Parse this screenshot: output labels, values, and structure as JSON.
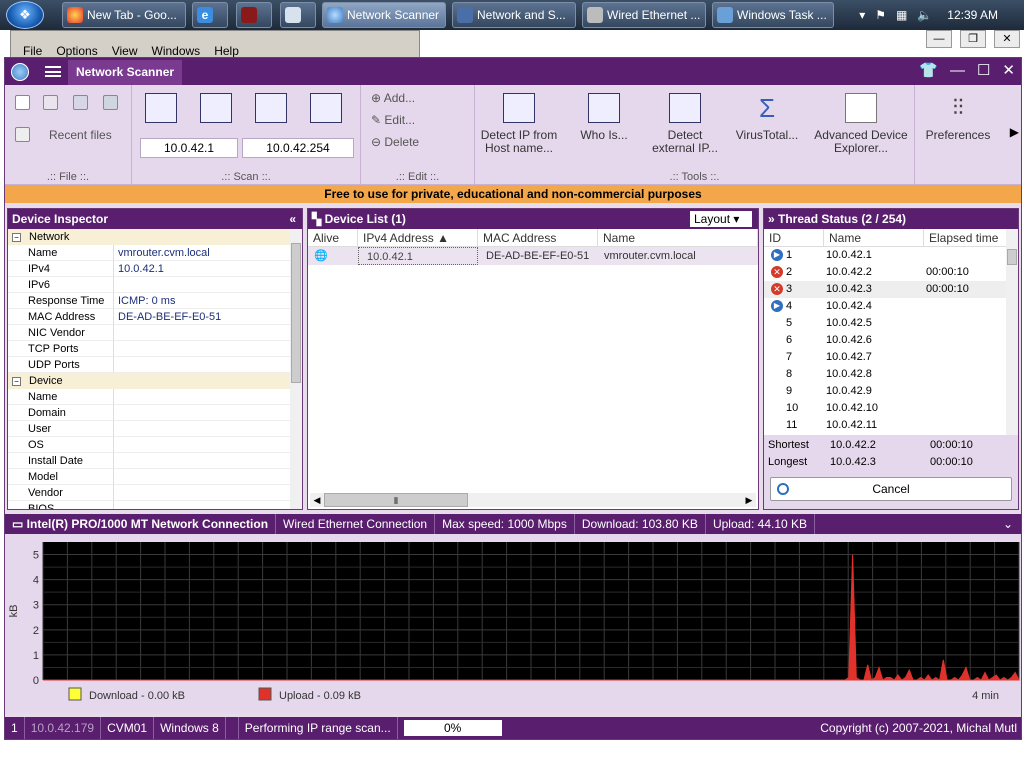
{
  "taskbar": {
    "tasks": [
      {
        "label": "New Tab - Goo..."
      },
      {
        "label": ""
      },
      {
        "label": ""
      },
      {
        "label": ""
      },
      {
        "label": "Network Scanner"
      },
      {
        "label": "Network and S..."
      },
      {
        "label": "Wired Ethernet ..."
      },
      {
        "label": "Windows Task ..."
      }
    ],
    "clock": "12:39 AM"
  },
  "bg_window": {
    "menu": [
      "File",
      "Options",
      "View",
      "Windows",
      "Help"
    ]
  },
  "app": {
    "tab": "Network Scanner",
    "ribbon": {
      "file": {
        "recent_label": "Recent files",
        "group_label": ".:: File ::."
      },
      "scan": {
        "from_ip": "10.0.42.1",
        "to_ip": "10.0.42.254",
        "group_label": ".:: Scan ::."
      },
      "edit": {
        "add": "Add...",
        "edit": "Edit...",
        "delete": "Delete",
        "group_label": ".:: Edit ::."
      },
      "tools": {
        "items": [
          "Detect IP from Host name...",
          "Who Is...",
          "Detect external IP...",
          "VirusTotal...",
          "Advanced Device Explorer..."
        ],
        "group_label": ".:: Tools ::."
      },
      "preferences": "Preferences"
    },
    "banner": "Free to use for private, educational and non-commercial  purposes"
  },
  "device_inspector": {
    "title": "Device Inspector",
    "groups": [
      {
        "name": "Network",
        "rows": [
          {
            "k": "Name",
            "v": "vmrouter.cvm.local"
          },
          {
            "k": "IPv4",
            "v": "10.0.42.1"
          },
          {
            "k": "IPv6",
            "v": ""
          },
          {
            "k": "Response Time",
            "v": "ICMP: 0 ms"
          },
          {
            "k": "MAC Address",
            "v": "DE-AD-BE-EF-E0-51"
          },
          {
            "k": "NIC Vendor",
            "v": ""
          },
          {
            "k": "TCP Ports",
            "v": ""
          },
          {
            "k": "UDP Ports",
            "v": ""
          }
        ]
      },
      {
        "name": "Device",
        "rows": [
          {
            "k": "Name",
            "v": ""
          },
          {
            "k": "Domain",
            "v": ""
          },
          {
            "k": "User",
            "v": ""
          },
          {
            "k": "OS",
            "v": ""
          },
          {
            "k": "Install Date",
            "v": ""
          },
          {
            "k": "Model",
            "v": ""
          },
          {
            "k": "Vendor",
            "v": ""
          },
          {
            "k": "BIOS",
            "v": ""
          }
        ]
      }
    ]
  },
  "device_list": {
    "title": "Device List (1)",
    "layout_label": "Layout",
    "columns": [
      "Alive",
      "IPv4 Address",
      "MAC Address",
      "Name"
    ],
    "rows": [
      {
        "ip": "10.0.42.1",
        "mac": "DE-AD-BE-EF-E0-51",
        "name": "vmrouter.cvm.local"
      }
    ]
  },
  "thread_status": {
    "title": "Thread Status (2 / 254)",
    "columns": [
      "ID",
      "Name",
      "Elapsed time"
    ],
    "rows": [
      {
        "state": "run",
        "id": "1",
        "name": "10.0.42.1",
        "time": ""
      },
      {
        "state": "err",
        "id": "2",
        "name": "10.0.42.2",
        "time": "00:00:10"
      },
      {
        "state": "err",
        "id": "3",
        "name": "10.0.42.3",
        "time": "00:00:10"
      },
      {
        "state": "run",
        "id": "4",
        "name": "10.0.42.4",
        "time": ""
      },
      {
        "state": "",
        "id": "5",
        "name": "10.0.42.5",
        "time": ""
      },
      {
        "state": "",
        "id": "6",
        "name": "10.0.42.6",
        "time": ""
      },
      {
        "state": "",
        "id": "7",
        "name": "10.0.42.7",
        "time": ""
      },
      {
        "state": "",
        "id": "8",
        "name": "10.0.42.8",
        "time": ""
      },
      {
        "state": "",
        "id": "9",
        "name": "10.0.42.9",
        "time": ""
      },
      {
        "state": "",
        "id": "10",
        "name": "10.0.42.10",
        "time": ""
      },
      {
        "state": "",
        "id": "11",
        "name": "10.0.42.11",
        "time": ""
      }
    ],
    "shortest": {
      "label": "Shortest",
      "name": "10.0.42.2",
      "time": "00:00:10"
    },
    "longest": {
      "label": "Longest",
      "name": "10.0.42.3",
      "time": "00:00:10"
    },
    "cancel": "Cancel"
  },
  "net_bar": {
    "adapter": "Intel(R) PRO/1000 MT Network Connection",
    "connection": "Wired Ethernet Connection",
    "max_speed": "Max speed: 1000 Mbps",
    "download": "Download: 103.80 KB",
    "upload": "Upload: 44.10 KB"
  },
  "chart_data": {
    "type": "area",
    "ylabel": "kB",
    "ylim": [
      0,
      5.5
    ],
    "yticks": [
      "0",
      "1",
      "2",
      "3",
      "4",
      "5"
    ],
    "xlabel_right": "4 min",
    "grid": true,
    "series": [
      {
        "name": "Download - 0.00 kB",
        "color": "#ffff33",
        "values": []
      },
      {
        "name": "Upload - 0.09 kB",
        "color": "#e0322a",
        "values": [
          0,
          0,
          0,
          0,
          0,
          0,
          0,
          0,
          0,
          0,
          0,
          0,
          0,
          0,
          0,
          0,
          0,
          0,
          0,
          0,
          0,
          0,
          0,
          0,
          0,
          0,
          0,
          0,
          0,
          0,
          0,
          0,
          0,
          0,
          0,
          0,
          0,
          0,
          0,
          0,
          0,
          0,
          0,
          0,
          0,
          0,
          0,
          0,
          0,
          0,
          0,
          0,
          0,
          0,
          0,
          0,
          0,
          0,
          0,
          0,
          0,
          0,
          0,
          0,
          0,
          0,
          0,
          0,
          0,
          0,
          0,
          0,
          0,
          0,
          0,
          0,
          0,
          0,
          0,
          0,
          0,
          0,
          0,
          0,
          0,
          0,
          0,
          0,
          0,
          0,
          0,
          0,
          0,
          0,
          0,
          0,
          0,
          0,
          0,
          0,
          0,
          0,
          0,
          0,
          0,
          0,
          0,
          0,
          0,
          0,
          0,
          0,
          0,
          0,
          0,
          0,
          0,
          0,
          0,
          0,
          0,
          0,
          0,
          0,
          0,
          0,
          0,
          0,
          0,
          0,
          0,
          0,
          0,
          0,
          0,
          0,
          0,
          0,
          0,
          0,
          0,
          0,
          0,
          0,
          0,
          0,
          0,
          0,
          0,
          0,
          0,
          0,
          0,
          0,
          0,
          0,
          0,
          0,
          0,
          0,
          0,
          0,
          0,
          0,
          0,
          0,
          0,
          0,
          0,
          0,
          0,
          0,
          0,
          0,
          0,
          0,
          0,
          0,
          0,
          0,
          0,
          0,
          0,
          0,
          0,
          0,
          0,
          0,
          0,
          0,
          0,
          0,
          0,
          0,
          0,
          0,
          0,
          0,
          0,
          0,
          0,
          0,
          0,
          0,
          0,
          0,
          0,
          0,
          0,
          0,
          0,
          0,
          0,
          0.1,
          5.0,
          0.1,
          0,
          0,
          0.6,
          0,
          0.1,
          0.5,
          0,
          0.1,
          0.1,
          0,
          0.2,
          0,
          0.1,
          0.4,
          0,
          0,
          0.1,
          0,
          0.2,
          0,
          0.1,
          0,
          0.8,
          0,
          0,
          0.1,
          0,
          0.2,
          0.5,
          0,
          0,
          0.1,
          0,
          0.3,
          0,
          0.1,
          0.2,
          0,
          0.1,
          0,
          0.1,
          0.3,
          0
        ]
      }
    ]
  },
  "status_bar": {
    "count": "1",
    "ip": "10.0.42.179",
    "host": "CVM01",
    "os": "Windows 8",
    "user": "",
    "task": "Performing IP range scan...",
    "progress": "0%",
    "copyright": "Copyright (c) 2007-2021, Michal Mutl"
  }
}
